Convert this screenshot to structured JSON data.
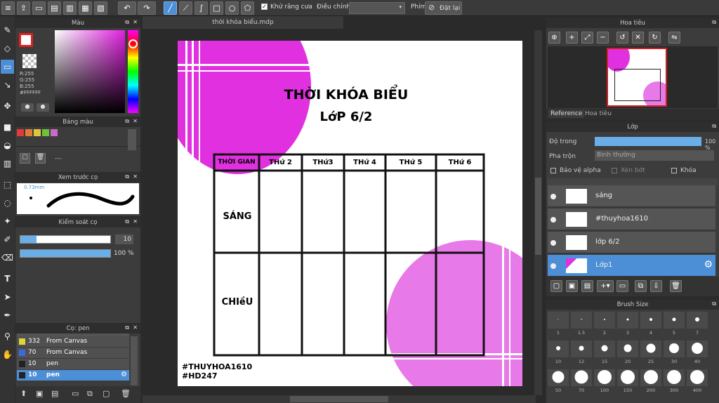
{
  "toolbar": {
    "antialias_label": "Khử răng cưa",
    "adjust_label": "Điều chỉnh",
    "key_label": "Phím",
    "reset_label": "Đặt lại"
  },
  "color_panel": {
    "title": "Màu",
    "r": "R:255",
    "g": "G:255",
    "b": "B:255",
    "hex": "#FFFFFF"
  },
  "palette_panel": {
    "title": "Bảng màu",
    "swatches": [
      "#e03a3a",
      "#e07b3a",
      "#e0c63a",
      "#6fc13a",
      "#c86ac8"
    ],
    "dash": "---"
  },
  "preview_panel": {
    "title": "Xem trước cọ",
    "size": "0.73mm"
  },
  "brush_control": {
    "title": "Kiểm soát cọ",
    "size_value": "10",
    "opacity_value": "100 %"
  },
  "brush_list": {
    "title": "Cọ: pen",
    "items": [
      {
        "size": "332",
        "name": "From Canvas",
        "color": "#e0d43a"
      },
      {
        "size": "70",
        "name": "From Canvas",
        "color": "#3a6ae0"
      },
      {
        "size": "10",
        "name": "pen",
        "color": "#222"
      },
      {
        "size": "10",
        "name": "pen",
        "color": "#222"
      }
    ]
  },
  "document": {
    "tab_title": "thời khóa biểu.mdp",
    "title_line1": "THỜI KHÓA BIỂU",
    "title_line2": "LớP 6/2",
    "headers": [
      "THỜI GIAN",
      "THứ 2",
      "THứ3",
      "THứ 4",
      "THứ 5",
      "THứ 6"
    ],
    "row1": "SÁNG",
    "row2": "CHIềU",
    "tag1": "#THUYHOA1610",
    "tag2": "#HD247"
  },
  "navigator": {
    "title": "Hoa tiêu",
    "tab_reference": "Reference",
    "tab_navigator": "Hoa tiêu"
  },
  "layer_panel": {
    "title": "Lớp",
    "opacity_label": "Độ trong",
    "opacity_value": "100 %",
    "blend_label": "Pha trộn",
    "blend_value": "Bình thường",
    "protect_alpha": "Bảo vệ alpha",
    "clipping": "Xén bớt",
    "lock": "Khóa",
    "layers": [
      "sáng",
      "#thuyhoa1610",
      "lớp 6/2",
      "Lớp1"
    ]
  },
  "brush_size": {
    "title": "Brush Size",
    "sizes": [
      "1",
      "1.5",
      "2",
      "3",
      "4",
      "5",
      "7",
      "10",
      "12",
      "15",
      "20",
      "25",
      "30",
      "40",
      "50",
      "70",
      "100",
      "150",
      "200",
      "300",
      "400"
    ]
  },
  "colors": {
    "accent": "#4d8fd6",
    "magenta": "#e030e0",
    "pink": "#e879e8"
  }
}
